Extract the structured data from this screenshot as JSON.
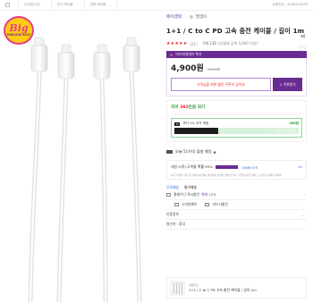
{
  "breadcrumb": {
    "items": [
      "디지털/가전",
      "전기/케이블",
      "전원 케이블"
    ],
    "product_code": "상품번호 : 3460913089"
  },
  "badge": {
    "title": "Big",
    "subtitle": "ENDLESS SALE"
  },
  "product": {
    "brand": "에이엠텍",
    "store": "엘앰비",
    "title": "1+1 / C to C PD 고속 충전 케이블 / 길이 1m",
    "stars": "★★★★★",
    "review_count": "(21)",
    "purchase_text": "구매 136",
    "purchase_note": "(실결제 금액 3,000 이상)"
  },
  "promo": {
    "bar_label": "빅스마일데이 특가",
    "price": "4,900원",
    "original_price": "9,000원",
    "coupon_text": "고객님을 위한 할인 쿠폰이 있어요",
    "coupon_button": "↓ 쿠폰받기"
  },
  "delivery": {
    "title_prefix": "지마 ",
    "title_count": "392",
    "title_suffix": "만원 되기",
    "card_tag": "Q",
    "card_text": "까지 1% 추가 적립",
    "card_pct": "265원",
    "bar_text": "◇ 스마일캐시 적립하기",
    "bar_fill_percent": 35
  },
  "arrival": {
    "label": "오늘 5(가치) 출발 예정",
    "caret": "▲",
    "row_label": "내일 5(목) 도착할 확률 99%",
    "bar_fill_percent": 99,
    "row_next": "5/6(토) 도착",
    "row_right": "1%",
    "note": "최근 3개월 기준 이 판매자의 배송 데이터를 분석한 결과입니다. (주말/공휴일 제외, 도서산간 제외) 자세히"
  },
  "shipping": {
    "label": "무료배송",
    "value": "통이배송"
  },
  "list": {
    "card_installment": "결제수단 즉시할인",
    "card_installment_hl": "최대 12%",
    "card_tag_1": "스마일페이",
    "card_tag_2": "카드사할인",
    "certification": "인증정보",
    "origin": "원산지 : 중국"
  },
  "mini_card": {
    "small": "상품정보",
    "name": "1+1 / C to C PD 고속 충전 케이블 / 길이 1m"
  },
  "colors": {
    "brand": "#6a2c91",
    "accent": "#e8262b",
    "green": "#2c9a3a",
    "link": "#2b6fd6"
  }
}
